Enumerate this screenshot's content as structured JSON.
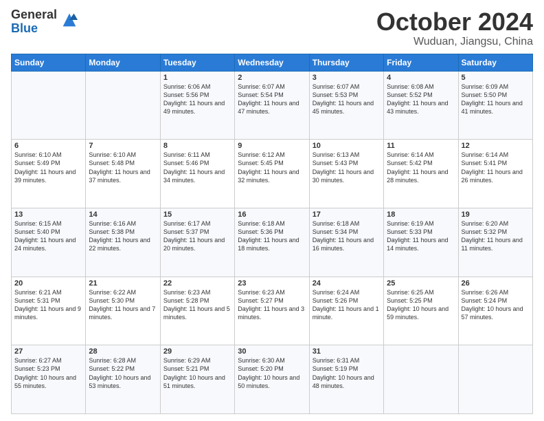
{
  "logo": {
    "general": "General",
    "blue": "Blue"
  },
  "title": "October 2024",
  "location": "Wuduan, Jiangsu, China",
  "days_of_week": [
    "Sunday",
    "Monday",
    "Tuesday",
    "Wednesday",
    "Thursday",
    "Friday",
    "Saturday"
  ],
  "weeks": [
    [
      {
        "day": "",
        "data": ""
      },
      {
        "day": "",
        "data": ""
      },
      {
        "day": "1",
        "data": "Sunrise: 6:06 AM\nSunset: 5:56 PM\nDaylight: 11 hours and 49 minutes."
      },
      {
        "day": "2",
        "data": "Sunrise: 6:07 AM\nSunset: 5:54 PM\nDaylight: 11 hours and 47 minutes."
      },
      {
        "day": "3",
        "data": "Sunrise: 6:07 AM\nSunset: 5:53 PM\nDaylight: 11 hours and 45 minutes."
      },
      {
        "day": "4",
        "data": "Sunrise: 6:08 AM\nSunset: 5:52 PM\nDaylight: 11 hours and 43 minutes."
      },
      {
        "day": "5",
        "data": "Sunrise: 6:09 AM\nSunset: 5:50 PM\nDaylight: 11 hours and 41 minutes."
      }
    ],
    [
      {
        "day": "6",
        "data": "Sunrise: 6:10 AM\nSunset: 5:49 PM\nDaylight: 11 hours and 39 minutes."
      },
      {
        "day": "7",
        "data": "Sunrise: 6:10 AM\nSunset: 5:48 PM\nDaylight: 11 hours and 37 minutes."
      },
      {
        "day": "8",
        "data": "Sunrise: 6:11 AM\nSunset: 5:46 PM\nDaylight: 11 hours and 34 minutes."
      },
      {
        "day": "9",
        "data": "Sunrise: 6:12 AM\nSunset: 5:45 PM\nDaylight: 11 hours and 32 minutes."
      },
      {
        "day": "10",
        "data": "Sunrise: 6:13 AM\nSunset: 5:43 PM\nDaylight: 11 hours and 30 minutes."
      },
      {
        "day": "11",
        "data": "Sunrise: 6:14 AM\nSunset: 5:42 PM\nDaylight: 11 hours and 28 minutes."
      },
      {
        "day": "12",
        "data": "Sunrise: 6:14 AM\nSunset: 5:41 PM\nDaylight: 11 hours and 26 minutes."
      }
    ],
    [
      {
        "day": "13",
        "data": "Sunrise: 6:15 AM\nSunset: 5:40 PM\nDaylight: 11 hours and 24 minutes."
      },
      {
        "day": "14",
        "data": "Sunrise: 6:16 AM\nSunset: 5:38 PM\nDaylight: 11 hours and 22 minutes."
      },
      {
        "day": "15",
        "data": "Sunrise: 6:17 AM\nSunset: 5:37 PM\nDaylight: 11 hours and 20 minutes."
      },
      {
        "day": "16",
        "data": "Sunrise: 6:18 AM\nSunset: 5:36 PM\nDaylight: 11 hours and 18 minutes."
      },
      {
        "day": "17",
        "data": "Sunrise: 6:18 AM\nSunset: 5:34 PM\nDaylight: 11 hours and 16 minutes."
      },
      {
        "day": "18",
        "data": "Sunrise: 6:19 AM\nSunset: 5:33 PM\nDaylight: 11 hours and 14 minutes."
      },
      {
        "day": "19",
        "data": "Sunrise: 6:20 AM\nSunset: 5:32 PM\nDaylight: 11 hours and 11 minutes."
      }
    ],
    [
      {
        "day": "20",
        "data": "Sunrise: 6:21 AM\nSunset: 5:31 PM\nDaylight: 11 hours and 9 minutes."
      },
      {
        "day": "21",
        "data": "Sunrise: 6:22 AM\nSunset: 5:30 PM\nDaylight: 11 hours and 7 minutes."
      },
      {
        "day": "22",
        "data": "Sunrise: 6:23 AM\nSunset: 5:28 PM\nDaylight: 11 hours and 5 minutes."
      },
      {
        "day": "23",
        "data": "Sunrise: 6:23 AM\nSunset: 5:27 PM\nDaylight: 11 hours and 3 minutes."
      },
      {
        "day": "24",
        "data": "Sunrise: 6:24 AM\nSunset: 5:26 PM\nDaylight: 11 hours and 1 minute."
      },
      {
        "day": "25",
        "data": "Sunrise: 6:25 AM\nSunset: 5:25 PM\nDaylight: 10 hours and 59 minutes."
      },
      {
        "day": "26",
        "data": "Sunrise: 6:26 AM\nSunset: 5:24 PM\nDaylight: 10 hours and 57 minutes."
      }
    ],
    [
      {
        "day": "27",
        "data": "Sunrise: 6:27 AM\nSunset: 5:23 PM\nDaylight: 10 hours and 55 minutes."
      },
      {
        "day": "28",
        "data": "Sunrise: 6:28 AM\nSunset: 5:22 PM\nDaylight: 10 hours and 53 minutes."
      },
      {
        "day": "29",
        "data": "Sunrise: 6:29 AM\nSunset: 5:21 PM\nDaylight: 10 hours and 51 minutes."
      },
      {
        "day": "30",
        "data": "Sunrise: 6:30 AM\nSunset: 5:20 PM\nDaylight: 10 hours and 50 minutes."
      },
      {
        "day": "31",
        "data": "Sunrise: 6:31 AM\nSunset: 5:19 PM\nDaylight: 10 hours and 48 minutes."
      },
      {
        "day": "",
        "data": ""
      },
      {
        "day": "",
        "data": ""
      }
    ]
  ]
}
